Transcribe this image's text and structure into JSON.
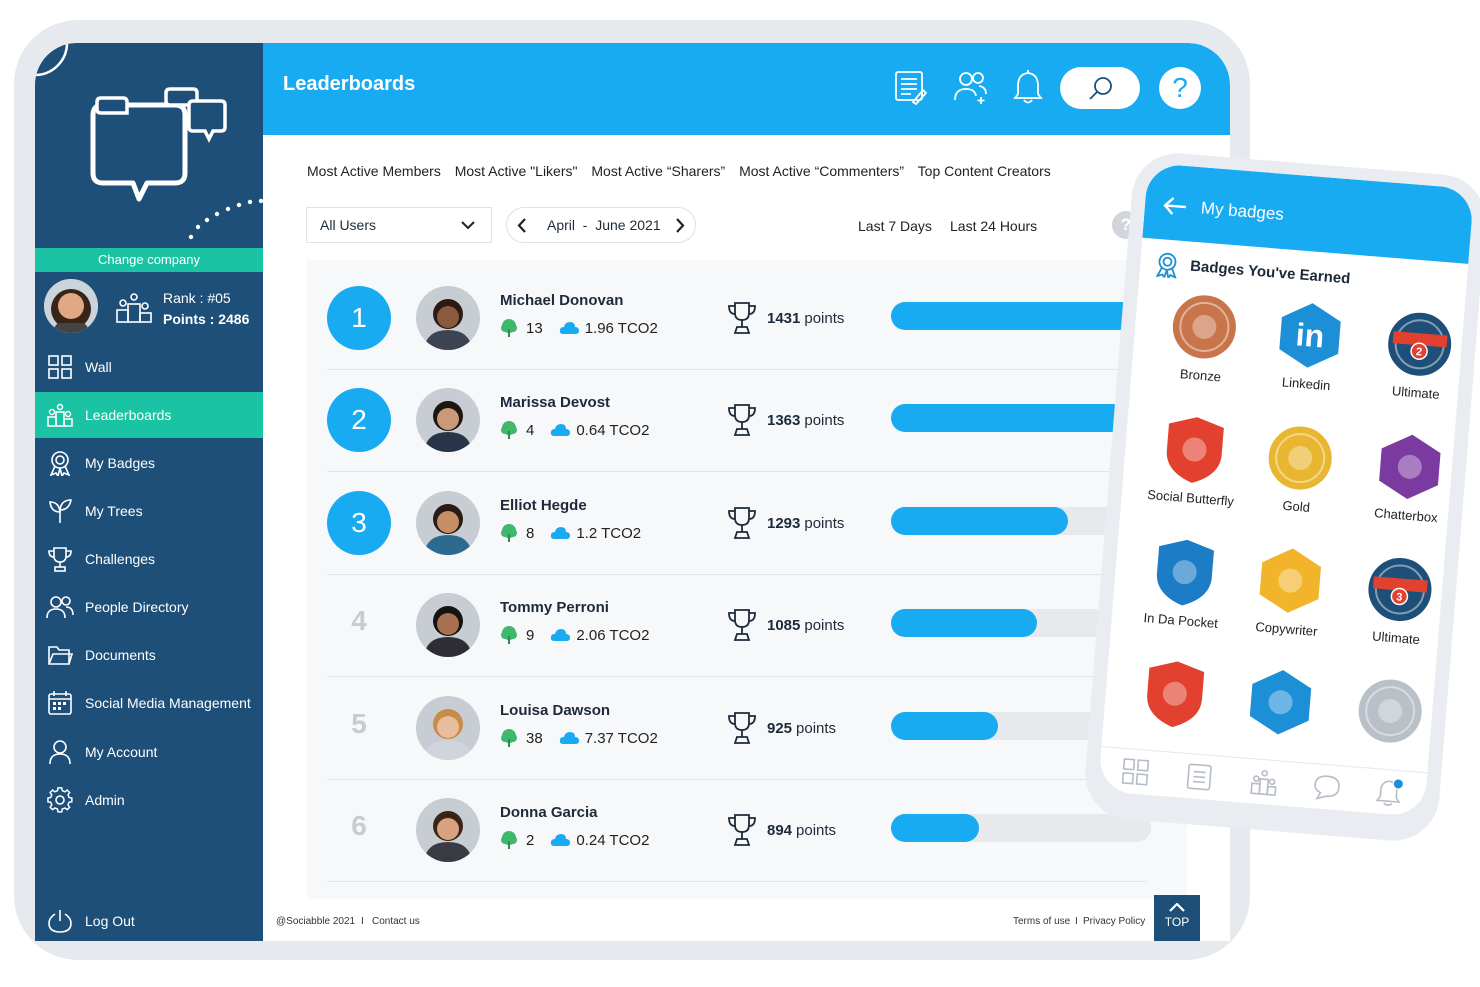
{
  "app": {
    "title": "Leaderboards"
  },
  "sidebar": {
    "change_company": "Change company",
    "user": {
      "rank": "Rank : #05",
      "points": "Points : 2486"
    },
    "items": [
      {
        "label": "Wall",
        "icon": "grid-icon"
      },
      {
        "label": "Leaderboards",
        "icon": "podium-icon",
        "active": true
      },
      {
        "label": "My Badges",
        "icon": "medal-icon"
      },
      {
        "label": "My Trees",
        "icon": "sprout-icon"
      },
      {
        "label": "Challenges",
        "icon": "trophy-icon"
      },
      {
        "label": "People Directory",
        "icon": "people-icon"
      },
      {
        "label": "Documents",
        "icon": "folder-icon"
      },
      {
        "label": "Social Media Management",
        "icon": "calendar-icon"
      },
      {
        "label": "My Account",
        "icon": "user-icon"
      },
      {
        "label": "Admin",
        "icon": "gear-icon"
      }
    ],
    "logout": "Log Out"
  },
  "tabs": [
    "Most Active Members",
    "Most Active \"Likers\"",
    "Most Active “Sharers”",
    "Most Active “Commenters”",
    "Top Content Creators"
  ],
  "filters": {
    "users": "All Users",
    "date_range": "April  -  June 2021",
    "last7": "Last 7 Days",
    "last24": "Last 24 Hours"
  },
  "leaders": [
    {
      "rank": "1",
      "name": "Michael Donovan",
      "trees": "13",
      "co2": "1.96 TCO2",
      "points": "1431",
      "fraction": 0.98,
      "skin": "#8a5a3c",
      "shirt": "#3b4450",
      "hair": "#2a1c14"
    },
    {
      "rank": "2",
      "name": "Marissa Devost",
      "trees": "4",
      "co2": "0.64 TCO2",
      "points": "1363",
      "fraction": 0.92,
      "skin": "#c99a78",
      "shirt": "#26354a",
      "hair": "#1d1712"
    },
    {
      "rank": "3",
      "name": "Elliot Hegde",
      "trees": "8",
      "co2": "1.2 TCO2",
      "points": "1293",
      "fraction": 0.68,
      "skin": "#c58e66",
      "shirt": "#2c6a8f",
      "hair": "#2a1c14"
    },
    {
      "rank": "4",
      "name": "Tommy Perroni",
      "trees": "9",
      "co2": "2.06 TCO2",
      "points": "1085",
      "fraction": 0.56,
      "skin": "#a87050",
      "shirt": "#2d2d33",
      "hair": "#151212"
    },
    {
      "rank": "5",
      "name": "Louisa Dawson",
      "trees": "38",
      "co2": "7.37 TCO2",
      "points": "925",
      "fraction": 0.41,
      "skin": "#e8bc9c",
      "shirt": "#d0d4dc",
      "hair": "#c98b48"
    },
    {
      "rank": "6",
      "name": "Donna Garcia",
      "trees": "2",
      "co2": "0.24 TCO2",
      "points": "894",
      "fraction": 0.34,
      "skin": "#d8a27e",
      "shirt": "#3a3a44",
      "hair": "#3a2418"
    }
  ],
  "points_suffix": "points",
  "footer": {
    "copyright": "@Sociabble 2021",
    "separator": "I",
    "contact": "Contact us",
    "terms": "Terms of use",
    "privacy": "Privacy Policy",
    "top": "TOP"
  },
  "phone": {
    "title": "My badges",
    "section": "Badges You've Earned",
    "badges": [
      {
        "label": "Bronze",
        "color": "#c9754b",
        "shape": "circle",
        "icon": "bronze-medal-icon"
      },
      {
        "label": "Linkedin",
        "color": "#1d8fd6",
        "shape": "hex",
        "text": "in",
        "icon": "linkedin-icon"
      },
      {
        "label": "Ultimate",
        "color": "#1e4f78",
        "shape": "circle",
        "text": "2",
        "icon": "ultimate-badge-icon"
      },
      {
        "label": "Social Butterfly",
        "color": "#e2412f",
        "shape": "shield",
        "icon": "chat-bubbles-icon"
      },
      {
        "label": "Gold",
        "color": "#e8b630",
        "shape": "circle",
        "icon": "gold-medal-icon"
      },
      {
        "label": "Chatterbox",
        "color": "#7a3aa0",
        "shape": "hex",
        "icon": "chatterbox-icon"
      },
      {
        "label": "In Da Pocket",
        "color": "#1d7cc6",
        "shape": "shield",
        "icon": "phone-icon"
      },
      {
        "label": "Copywriter",
        "color": "#f2b42a",
        "shape": "hex",
        "icon": "quill-icon"
      },
      {
        "label": "Ultimate",
        "color": "#1e4f78",
        "shape": "circle",
        "text": "3",
        "icon": "ultimate-badge-icon"
      },
      {
        "label": "",
        "color": "#e2412f",
        "shape": "shield",
        "icon": "thumbs-up-icon"
      },
      {
        "label": "",
        "color": "#1d8fd6",
        "shape": "hex",
        "icon": "twitter-icon"
      },
      {
        "label": "",
        "color": "#b9c0c8",
        "shape": "circle",
        "icon": "silver-medal-icon"
      }
    ]
  }
}
